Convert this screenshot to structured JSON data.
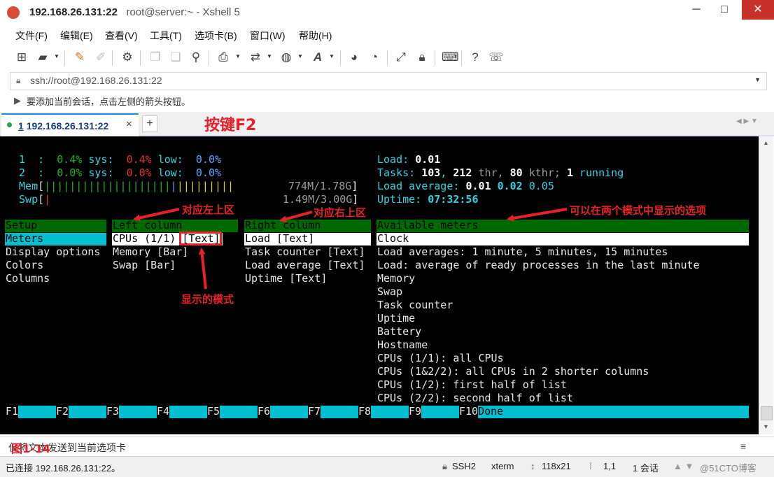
{
  "window": {
    "title_host": "192.168.26.131:22",
    "title_rest": "root@server:~ - Xshell 5",
    "minimize": "─",
    "maximize": "□",
    "close": "✕"
  },
  "menu": [
    "文件(F)",
    "编辑(E)",
    "查看(V)",
    "工具(T)",
    "选项卡(B)",
    "窗口(W)",
    "帮助(H)"
  ],
  "address": {
    "value": "ssh://root@192.168.26.131:22"
  },
  "hint": "要添加当前会话，点击左侧的箭头按钮。",
  "tab": {
    "number": "1",
    "label": "192.168.26.131:22",
    "close": "×",
    "add": "+"
  },
  "annotations": {
    "press_key": "按键F2",
    "left_area": "对应左上区",
    "right_area": "对应右上区",
    "both_modes": "可以在两个模式中显示的选项",
    "display_mode": "显示的模式",
    "figure": "图1-14"
  },
  "htop": {
    "cpu1": {
      "num": "1",
      "colon": ":",
      "pct": "0.4%",
      "sys_label": "sys:",
      "sys": "0.4%",
      "low_label": "low:",
      "low": "0.0%"
    },
    "cpu2": {
      "num": "2",
      "colon": ":",
      "pct": "0.0%",
      "sys_label": "sys:",
      "sys": "0.0%",
      "low_label": "low:",
      "low": "0.0%"
    },
    "mem": {
      "label": "Mem",
      "bar_green": "||||||||||||||||||||",
      "bar_blue": "|",
      "bar_yellow": "|||||||||",
      "value": "774M/1.78G"
    },
    "swp": {
      "label": "Swp",
      "bar_red": "|",
      "value": "1.49M/3.00G"
    },
    "load": {
      "label": "Load:",
      "value": "0.01"
    },
    "tasks": {
      "label": "Tasks:",
      "count": "103",
      "thr": "212",
      "thr_label": "thr,",
      "kthr": "80",
      "kthr_label": "kthr;",
      "running": "1",
      "running_label": "running"
    },
    "load_avg": {
      "label": "Load average:",
      "v1": "0.01",
      "v2": "0.02",
      "v3": "0.05"
    },
    "uptime": {
      "label": "Uptime:",
      "value": "07:32:56"
    }
  },
  "setup": {
    "header": "Setup",
    "items": [
      "Meters",
      "Display options",
      "Colors",
      "Columns"
    ]
  },
  "left_column": {
    "header": "Left column",
    "items": [
      {
        "name": "CPUs (1/1)",
        "mode": "[Text]"
      },
      {
        "name": "Memory",
        "mode": "[Bar]"
      },
      {
        "name": "Swap",
        "mode": "[Bar]"
      }
    ]
  },
  "right_column": {
    "header": "Right column",
    "items": [
      {
        "name": "Load",
        "mode": "[Text]"
      },
      {
        "name": "Task counter",
        "mode": "[Text]"
      },
      {
        "name": "Load average",
        "mode": "[Text]"
      },
      {
        "name": "Uptime",
        "mode": "[Text]"
      }
    ]
  },
  "available": {
    "header": "Available meters",
    "items": [
      "Clock",
      "Load averages: 1 minute, 5 minutes, 15 minutes",
      "Load: average of ready processes in the last minute",
      "Memory",
      "Swap",
      "Task counter",
      "Uptime",
      "Battery",
      "Hostname",
      "CPUs (1/1): all CPUs",
      "CPUs (1&2/2): all CPUs in 2 shorter columns",
      "CPUs (1/2): first half of list",
      "CPUs (2/2): second half of list"
    ]
  },
  "fkeys": [
    "F1",
    "F2",
    "F3",
    "F4",
    "F5",
    "F6",
    "F7",
    "F8",
    "F9",
    "F10"
  ],
  "fkey_done": "Done",
  "inputbar": {
    "text": "仅将文本发送到当前选项卡",
    "menu_icon": "≡"
  },
  "status": {
    "connected": "已连接 192.168.26.131:22。",
    "protocol": "SSH2",
    "term": "xterm",
    "size": "118x21",
    "pos": "1,1",
    "sessions": "1 会话",
    "watermark": "@51CTO博客"
  },
  "colors": {
    "accent_tab": "#1e8ae6",
    "annotation": "#e8202a",
    "header_green": "#006400",
    "cyan_band": "#00c0d0"
  }
}
